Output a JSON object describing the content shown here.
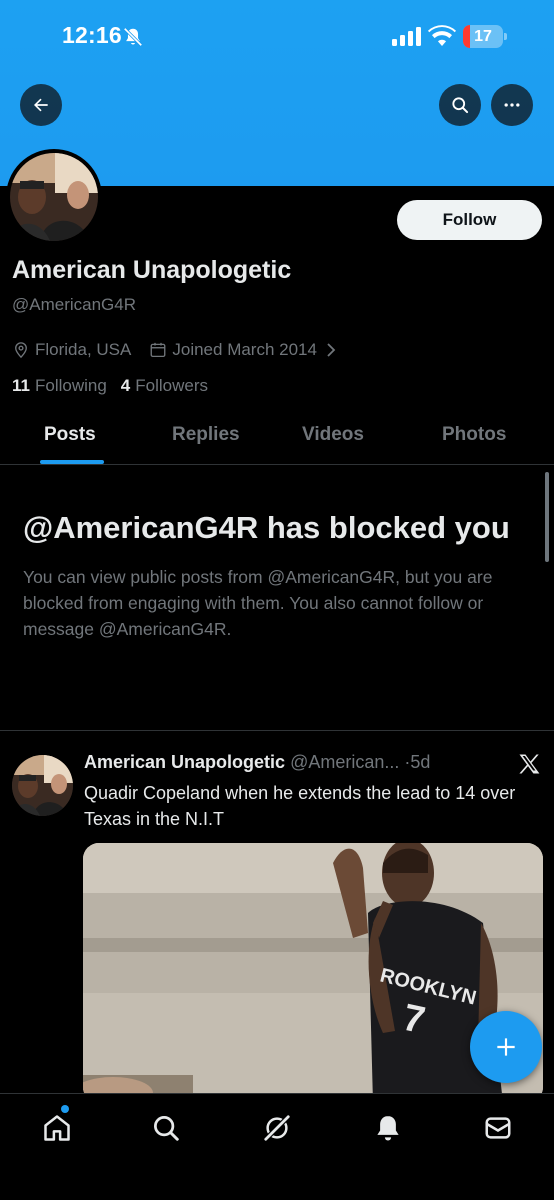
{
  "status_bar": {
    "time": "12:16",
    "battery_level": "17",
    "battery_fraction": 0.17
  },
  "header": {
    "back_icon": "arrow-left-icon",
    "search_icon": "search-icon",
    "more_icon": "more-horizontal-icon",
    "banner_color": "#1d9bf0"
  },
  "profile": {
    "display_name": "American Unapologetic",
    "handle": "@AmericanG4R",
    "follow_label": "Follow",
    "location": "Florida, USA",
    "joined": "Joined March 2014",
    "following_count": "11",
    "following_label": "Following",
    "followers_count": "4",
    "followers_label": "Followers"
  },
  "tabs": [
    {
      "label": "Posts",
      "active": true
    },
    {
      "label": "Replies",
      "active": false
    },
    {
      "label": "Videos",
      "active": false
    },
    {
      "label": "Photos",
      "active": false
    }
  ],
  "blocked": {
    "title": "@AmericanG4R has blocked you",
    "description": "You can view public posts from @AmericanG4R, but you are blocked from engaging with them. You also cannot follow or message @AmericanG4R."
  },
  "post": {
    "name": "American Unapologetic",
    "handle": "@American...",
    "separator": "·",
    "time": "5d",
    "text": "Quadir Copeland when he extends the lead to 14 over Texas in the N.I.T",
    "jersey_text": "ROOKLYN",
    "jersey_number": "7"
  },
  "fab": {
    "icon": "plus-icon"
  },
  "bottom_nav": {
    "items": [
      "home-icon",
      "search-icon",
      "grok-icon",
      "notifications-icon",
      "messages-icon"
    ]
  },
  "colors": {
    "accent": "#1d9bf0",
    "background": "#000000",
    "text_primary": "#e7e9ea",
    "text_secondary": "#71767b"
  }
}
